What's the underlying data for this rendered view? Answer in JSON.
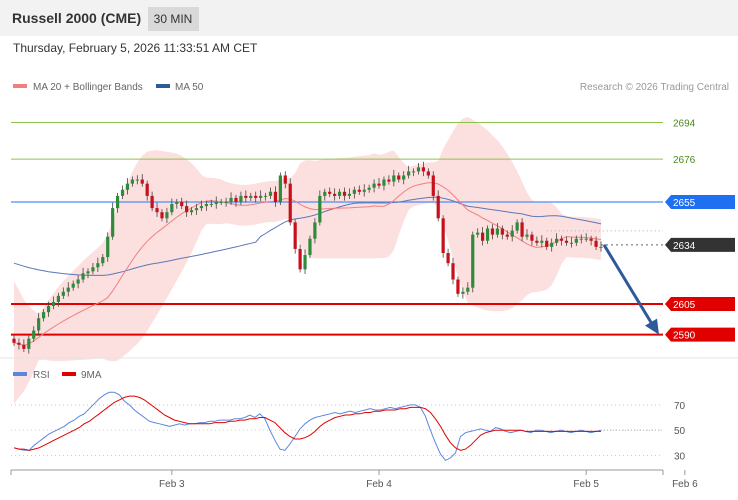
{
  "header": {
    "instrument": "Russell 2000 (CME)",
    "timeframe": "30 MIN",
    "datetime": "Thursday, February 5, 2026 11:33:51 AM CET"
  },
  "legend_main": [
    {
      "label": "MA 20 + Bollinger Bands",
      "color": "#f08080"
    },
    {
      "label": "MA 50",
      "color": "#2e5a9c"
    }
  ],
  "credit": "Research © 2026 Trading Central",
  "legend_rsi": [
    {
      "label": "RSI",
      "color": "#5b86e0"
    },
    {
      "label": "9MA",
      "color": "#e00000"
    }
  ],
  "colors": {
    "bull": "#2e8b3a",
    "bear": "#c8101c",
    "band_fill": "#fbd4d4",
    "ma20": "#f08080",
    "ma50": "#5b78b8",
    "resistance_line": "#8bc34a",
    "pivot_line": "#4f8ef7",
    "support_line": "#e00000",
    "current_tag": "#333333",
    "arrow": "#2e5a9c"
  },
  "chart_data": [
    {
      "type": "candlestick",
      "title": "Russell 2000 (CME) 30 MIN",
      "x_tick_labels": [
        "Feb 3",
        "Feb 4",
        "Feb 5",
        "Feb 6"
      ],
      "x_tick_bar_index": [
        32,
        74,
        116,
        136
      ],
      "ylim": [
        2580,
        2705
      ],
      "levels": [
        {
          "value": 2694,
          "label": "2694",
          "kind": "resistance"
        },
        {
          "value": 2676,
          "label": "2676",
          "kind": "resistance"
        },
        {
          "value": 2655,
          "label": "2655",
          "kind": "pivot"
        },
        {
          "value": 2634,
          "label": "2634",
          "kind": "current"
        },
        {
          "value": 2605,
          "label": "2605",
          "kind": "support"
        },
        {
          "value": 2590,
          "label": "2590",
          "kind": "support"
        }
      ],
      "forecast_arrow": {
        "from": 2634,
        "to": 2590
      },
      "close": [
        2586,
        2585,
        2583,
        2588,
        2592,
        2598,
        2601,
        2604,
        2606,
        2609,
        2611,
        2613,
        2615,
        2617,
        2620,
        2621,
        2623,
        2625,
        2628,
        2638,
        2652,
        2658,
        2661,
        2664,
        2666,
        2666,
        2664,
        2658,
        2652,
        2650,
        2647,
        2650,
        2654,
        2655,
        2653,
        2650,
        2651,
        2652,
        2653,
        2654,
        2654,
        2655,
        2655,
        2655,
        2657,
        2655,
        2658,
        2657,
        2658,
        2657,
        2658,
        2658,
        2660,
        2655,
        2668,
        2664,
        2645,
        2632,
        2622,
        2629,
        2637,
        2645,
        2658,
        2660,
        2659,
        2658,
        2660,
        2658,
        2659,
        2661,
        2660,
        2661,
        2662,
        2664,
        2663,
        2666,
        2665,
        2668,
        2666,
        2668,
        2670,
        2670,
        2672,
        2670,
        2668,
        2658,
        2647,
        2630,
        2625,
        2617,
        2610,
        2611,
        2613,
        2639,
        2640,
        2636,
        2642,
        2639,
        2642,
        2639,
        2638,
        2641,
        2645,
        2638,
        2639,
        2636,
        2635,
        2636,
        2633,
        2635,
        2637,
        2636,
        2635,
        2635,
        2637,
        2637,
        2637,
        2636,
        2633,
        2633
      ],
      "indicators": {
        "ma50_start": 2625,
        "ma50_end": 2648,
        "bb_width_start": 30,
        "bb_width_min": 10
      }
    },
    {
      "type": "line",
      "title": "RSI",
      "ylim": [
        20,
        85
      ],
      "y_ticks": [
        30,
        50,
        70
      ],
      "series": [
        {
          "name": "RSI",
          "values": [
            36,
            35,
            34,
            34,
            38,
            41,
            44,
            47,
            49,
            51,
            53,
            56,
            58,
            61,
            63,
            67,
            71,
            75,
            78,
            80,
            80,
            78,
            73,
            70,
            66,
            63,
            60,
            57,
            56,
            55,
            54,
            53,
            54,
            55,
            54,
            55,
            55,
            56,
            56,
            57,
            57,
            58,
            58,
            58,
            59,
            59,
            60,
            62,
            60,
            63,
            59,
            50,
            42,
            35,
            34,
            39,
            45,
            51,
            55,
            58,
            60,
            61,
            62,
            63,
            64,
            63,
            64,
            65,
            64,
            65,
            66,
            67,
            66,
            66,
            67,
            68,
            67,
            68,
            69,
            70,
            70,
            68,
            61,
            50,
            40,
            31,
            26,
            28,
            32,
            45,
            48,
            49,
            50,
            51,
            50,
            49,
            52,
            51,
            49,
            48,
            49,
            50,
            49,
            48,
            50,
            50,
            49,
            48,
            49,
            50,
            49,
            48,
            49,
            50,
            49,
            48,
            49,
            50
          ]
        },
        {
          "name": "9MA",
          "values": [
            36,
            35,
            35,
            34,
            35,
            36,
            38,
            40,
            42,
            44,
            46,
            48,
            50,
            52,
            55,
            57,
            60,
            63,
            66,
            69,
            72,
            74,
            76,
            77,
            77,
            76,
            74,
            71,
            68,
            65,
            62,
            60,
            58,
            57,
            56,
            55,
            55,
            55,
            55,
            55,
            56,
            56,
            56,
            57,
            57,
            58,
            58,
            59,
            59,
            60,
            60,
            58,
            56,
            52,
            48,
            45,
            43,
            43,
            44,
            46,
            49,
            53,
            56,
            58,
            60,
            61,
            62,
            62,
            63,
            63,
            64,
            64,
            65,
            65,
            66,
            66,
            66,
            67,
            67,
            68,
            68,
            68,
            67,
            64,
            59,
            53,
            46,
            40,
            36,
            34,
            35,
            38,
            42,
            46,
            48,
            49,
            50,
            50,
            50,
            50,
            50,
            50,
            49,
            49,
            49,
            49,
            49,
            49,
            49,
            49,
            49,
            49,
            49,
            49,
            49,
            49,
            49,
            49
          ]
        }
      ]
    }
  ]
}
